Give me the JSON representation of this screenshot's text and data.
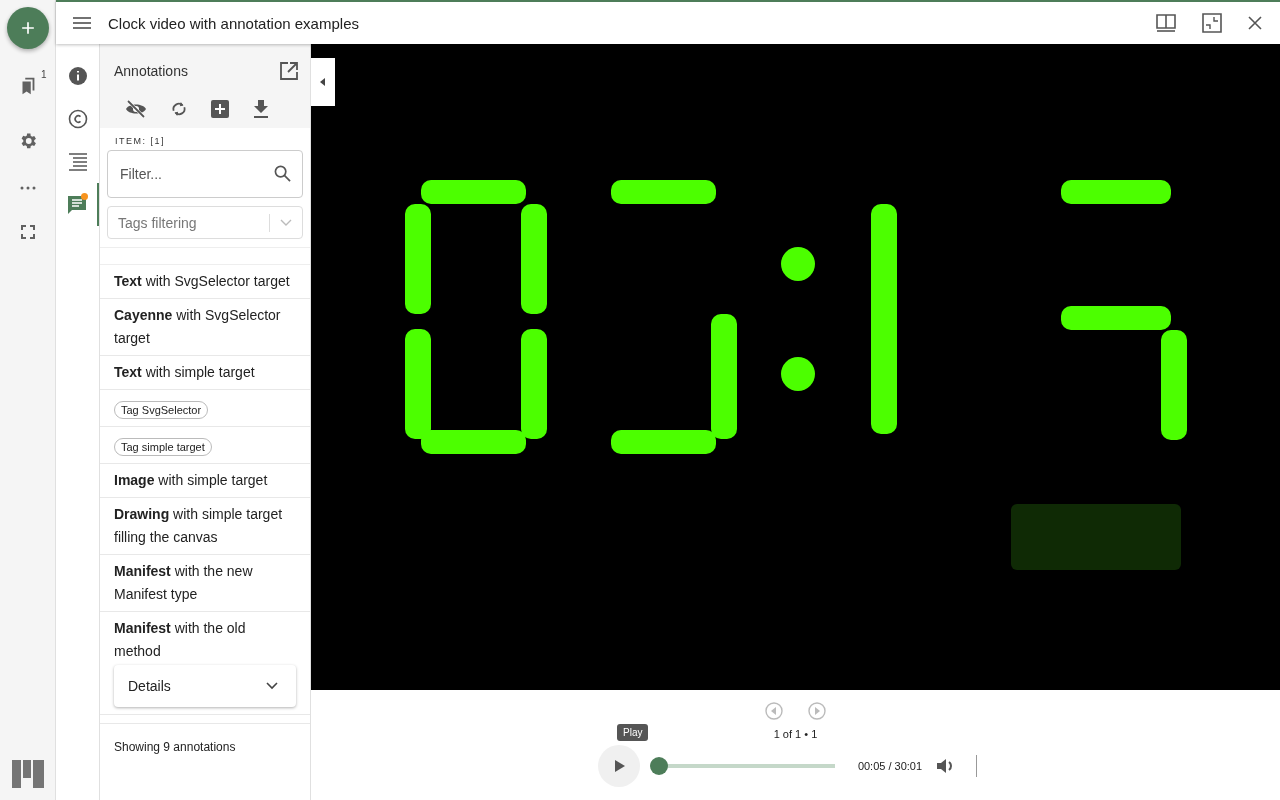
{
  "window": {
    "title": "Clock video with annotation examples"
  },
  "rail": {
    "bookmark_badge": "1"
  },
  "companion_tabs": [
    {
      "kind": "info",
      "selected": false
    },
    {
      "kind": "copyright",
      "selected": false
    },
    {
      "kind": "toc",
      "selected": false
    },
    {
      "kind": "annotations",
      "selected": true,
      "notice": true
    }
  ],
  "panel": {
    "title": "Annotations",
    "item_label": "ITEM: [1]",
    "filter": {
      "placeholder": "Filter..."
    },
    "tags": {
      "placeholder": "Tags filtering"
    },
    "annotations": [
      {
        "kind": "text",
        "text": "**Text** with SvgSelector target"
      },
      {
        "kind": "text",
        "text": "**Cayenne** with SvgSelector target"
      },
      {
        "kind": "text",
        "text": "**Text** with simple target"
      },
      {
        "kind": "tag",
        "text": "Tag SvgSelector"
      },
      {
        "kind": "tag",
        "text": "Tag simple target"
      },
      {
        "kind": "text",
        "text": "**Image** with simple target"
      },
      {
        "kind": "text",
        "text": "**Drawing** with simple target filling the canvas"
      },
      {
        "kind": "text",
        "text": "**Manifest** with the new Manifest type"
      },
      {
        "kind": "details",
        "text": "**Manifest** with the old method",
        "details": "Details"
      }
    ],
    "footer": "Showing 9 annotations"
  },
  "player": {
    "pager": "1 of 1 • 1",
    "tooltip": "Play",
    "time": "00:05 / 30:01",
    "level": 0.0
  }
}
